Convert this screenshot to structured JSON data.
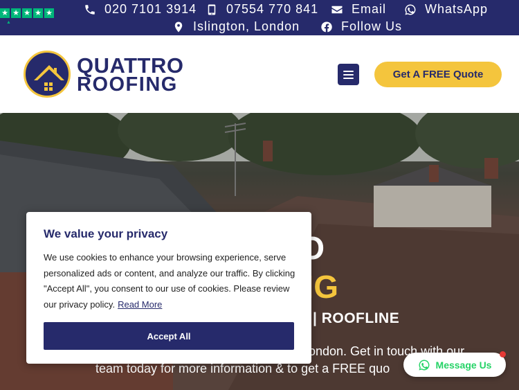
{
  "topbar": {
    "trustpilot_stars": [
      "★",
      "★",
      "★",
      "★",
      "★"
    ],
    "phone1": "020 7101 3914",
    "phone2": "07554 770 841",
    "email": "Email",
    "whatsapp": "WhatsApp",
    "location": "Islington, London",
    "follow": "Follow Us"
  },
  "header": {
    "logo_line1": "QUATTRO",
    "logo_line2": "ROOFING",
    "quote_button": "Get A FREE Quote"
  },
  "hero": {
    "title_line1": "RO",
    "title_line2": "NG",
    "subtitle": "|   ROOFLINE",
    "body_line1": "ondon. Get in touch with our",
    "body_line2": "team today for more information & to get a FREE quo"
  },
  "cookie": {
    "title": "We value your privacy",
    "text": "We use cookies to enhance your browsing experience, serve personalized ads or content, and analyze our traffic. By clicking \"Accept All\", you consent to our use of cookies. Please review our privacy policy.",
    "link": "Read More",
    "accept": "Accept All"
  },
  "chat": {
    "label": "Message Us"
  },
  "colors": {
    "navy": "#262a6b",
    "yellow": "#f4c53d",
    "whatsapp_green": "#25d366",
    "trustpilot_green": "#00b67a"
  }
}
